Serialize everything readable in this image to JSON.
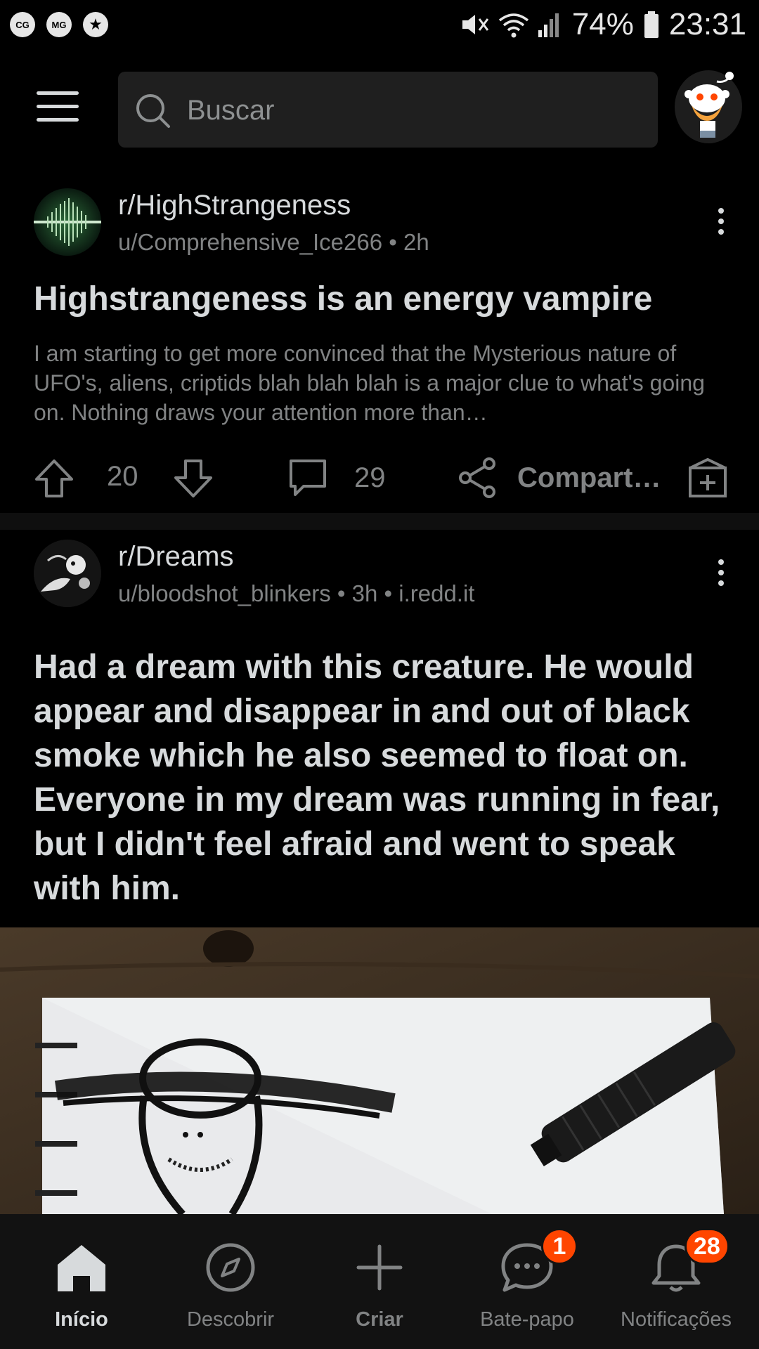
{
  "status_bar": {
    "left_badges": [
      "CG",
      "MG",
      "★"
    ],
    "battery": "74%",
    "time": "23:31",
    "icons": [
      "mute-icon",
      "wifi-icon",
      "signal-icon",
      "battery-icon"
    ]
  },
  "header": {
    "search_placeholder": "Buscar",
    "icons": [
      "menu-icon",
      "search-icon",
      "avatar"
    ]
  },
  "feed": [
    {
      "subreddit": "r/HighStrangeness",
      "author": "u/Comprehensive_Ice266",
      "age": "2h",
      "title": "Highstrangeness is an energy vampire",
      "body": "I am starting to get more convinced that the Mysterious nature of UFO's, aliens, criptids blah blah blah is a major clue to what's going on. Nothing draws your attention more than…",
      "upvotes": "20",
      "comments": "29",
      "share_label": "Compart…"
    },
    {
      "subreddit": "r/Dreams",
      "author": "u/bloodshot_blinkers",
      "age": "3h",
      "domain": "i.redd.it",
      "title": "Had a dream with this creature. He would appear and disappear in and out of black smoke which he also seemed to float on. Everyone in my dream was running in fear, but I didn't feel afraid and went to speak with him."
    }
  ],
  "separator": "•",
  "bottom_nav": [
    {
      "label": "Início",
      "icon": "home-icon",
      "active": true
    },
    {
      "label": "Descobrir",
      "icon": "compass-icon"
    },
    {
      "label": "Criar",
      "icon": "plus-icon"
    },
    {
      "label": "Bate-papo",
      "icon": "chat-icon",
      "badge": "1"
    },
    {
      "label": "Notificações",
      "icon": "bell-icon",
      "badge": "28"
    }
  ],
  "colors": {
    "background": "#000000",
    "text": "#d7dadc",
    "muted": "#818384",
    "accent": "#ff4500"
  }
}
